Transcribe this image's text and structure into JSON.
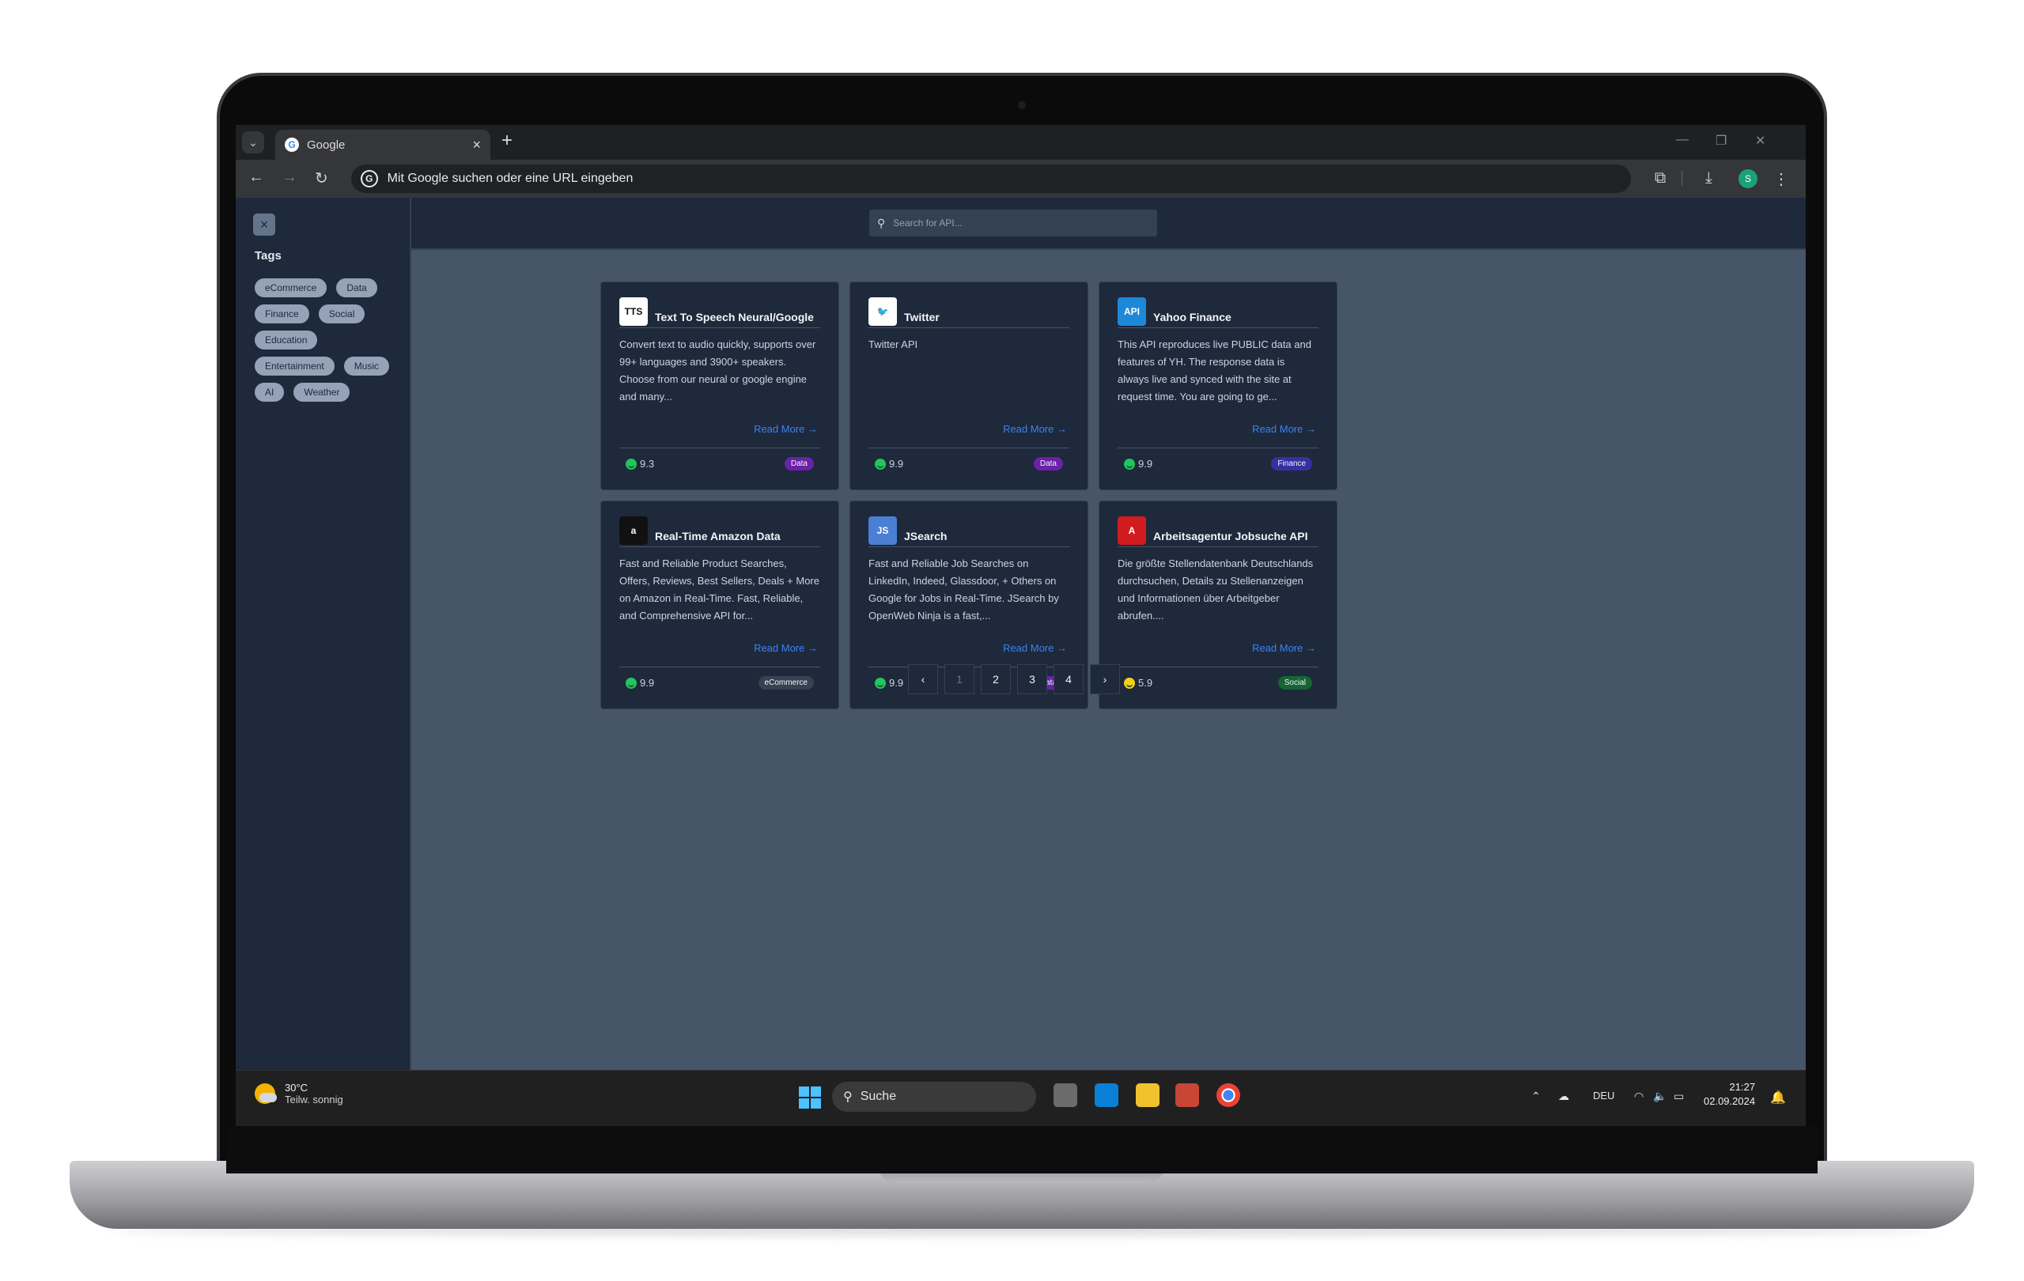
{
  "browser": {
    "tab_title": "Google",
    "tab_close": "×",
    "new_tab": "+",
    "omnibox_placeholder": "Mit Google suchen oder eine URL eingeben",
    "profile_initial": "S"
  },
  "sidebar": {
    "close_label": "×",
    "tags_title": "Tags",
    "tags": [
      "eCommerce",
      "Data",
      "Finance",
      "Social",
      "Education",
      "Entertainment",
      "Music",
      "AI",
      "Weather"
    ]
  },
  "search": {
    "placeholder": "Search for API..."
  },
  "cards": [
    {
      "title": "Text To Speech Neural/Google",
      "logo": "TTS",
      "description": "Convert text to audio quickly, supports over 99+ languages and 3900+ speakers. Choose from our neural or google engine and many...",
      "read_more": "Read More",
      "rating": "9.3",
      "tag": "Data",
      "tag_color": "#6b21a8",
      "logo_bg": "#ffffff",
      "logo_fg": "#111111"
    },
    {
      "title": "Twitter",
      "logo": "🐦",
      "description": "Twitter API",
      "read_more": "Read More",
      "rating": "9.9",
      "tag": "Data",
      "tag_color": "#6b21a8",
      "logo_bg": "#ffffff",
      "logo_fg": "#1d9bf0"
    },
    {
      "title": "Yahoo Finance",
      "logo": "API",
      "description": "This API reproduces live PUBLIC data and features of YH. The response data is always live and synced with the site at request time. You are going to ge...",
      "read_more": "Read More",
      "rating": "9.9",
      "tag": "Finance",
      "tag_color": "#3730a3",
      "logo_bg": "#1e88d8",
      "logo_fg": "#ffffff"
    },
    {
      "title": "Real-Time Amazon Data",
      "logo": "a",
      "description": "Fast and Reliable Product Searches, Offers, Reviews, Best Sellers, Deals + More on Amazon in Real-Time. Fast, Reliable, and Comprehensive API for...",
      "read_more": "Read More",
      "rating": "9.9",
      "tag": "eCommerce",
      "tag_color": "#374151",
      "logo_bg": "#111111",
      "logo_fg": "#ffffff"
    },
    {
      "title": "JSearch",
      "logo": "JS",
      "description": "Fast and Reliable Job Searches on LinkedIn, Indeed, Glassdoor, + Others on Google for Jobs in Real-Time. JSearch by OpenWeb Ninja is a fast,...",
      "read_more": "Read More",
      "rating": "9.9",
      "tag": "Data",
      "tag_color": "#6b21a8",
      "logo_bg": "#4a7fd4",
      "logo_fg": "#ffffff"
    },
    {
      "title": "Arbeitsagentur Jobsuche API",
      "logo": "A",
      "description": "Die größte Stellendatenbank Deutschlands durchsuchen, Details zu Stellenanzeigen und Informationen über Arbeitgeber abrufen....",
      "read_more": "Read More",
      "rating": "5.9",
      "tag": "Social",
      "tag_color": "#166534",
      "logo_bg": "#d01c1f",
      "logo_fg": "#ffffff"
    }
  ],
  "pagination": {
    "prev": "‹",
    "pages": [
      "1",
      "2",
      "3",
      "4"
    ],
    "next": "›",
    "active": "1"
  },
  "taskbar": {
    "temperature": "30°C",
    "weather": "Teilw. sonnig",
    "search_label": "Suche",
    "language": "DEU",
    "time": "21:27",
    "date": "02.09.2024"
  }
}
